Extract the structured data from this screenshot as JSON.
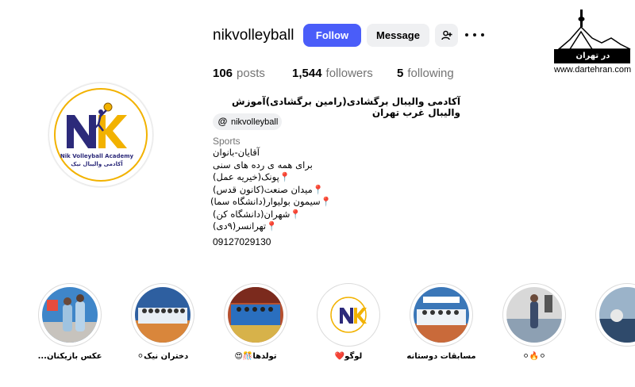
{
  "profile": {
    "username": "nikvolleyball",
    "follow_label": "Follow",
    "message_label": "Message",
    "posts_count": "106",
    "posts_label": "posts",
    "followers_count": "1,544",
    "followers_label": "followers",
    "following_count": "5",
    "following_label": "following",
    "full_name": "آکادمی والیبال برگشادی(رامین برگشادی)آموزش والیبال غرب تهران",
    "threads_handle": "nikvolleyball",
    "category": "Sports",
    "bio": [
      "آقایان-بانوان",
      "برای همه ی رده های سنی",
      "📍پونک(خیریه عمل)",
      "📍میدان صنعت(کانون قدس)",
      "📍سیمون بولیوار(دانشگاه سما)",
      "📍شهران(دانشگاه کن)",
      "📍تهرانسر(۹دی)"
    ],
    "phone": "09127029130",
    "avatar": {
      "line1": "Nik Volleyball Academy",
      "line2": "آکادمی والیبال نیک"
    }
  },
  "highlights": [
    {
      "label": "عکس بازیکنان..."
    },
    {
      "label": "دختران نیک⚪"
    },
    {
      "label": "تولدها🎊😍"
    },
    {
      "label": "لوگو❤️"
    },
    {
      "label": "مسابقات دوستانه"
    },
    {
      "label": "⚪🔥⚪"
    },
    {
      "label": ""
    }
  ],
  "watermark": {
    "name": "در تهران",
    "url": "www.dartehran.com"
  },
  "colors": {
    "follow_button": "#4a5df9",
    "secondary_button": "#eff0f2",
    "muted_text": "#737373",
    "logo_navy": "#2c2a7a",
    "logo_gold": "#f2b200"
  }
}
